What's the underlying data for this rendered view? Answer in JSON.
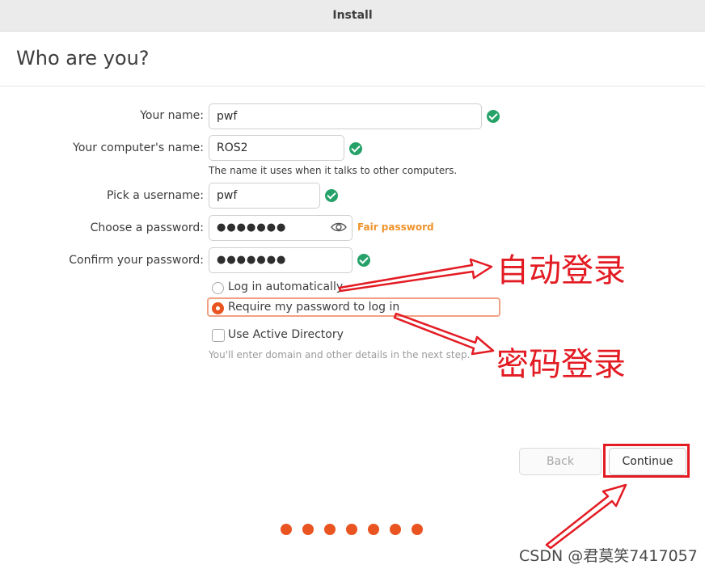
{
  "window": {
    "title": "Install"
  },
  "page": {
    "heading": "Who are you?"
  },
  "form": {
    "name_label": "Your name:",
    "name_value": "pwf",
    "computer_label": "Your computer's name:",
    "computer_value": "ROS2",
    "computer_hint": "The name it uses when it talks to other computers.",
    "username_label": "Pick a username:",
    "username_value": "pwf",
    "password_label": "Choose a password:",
    "password_value": "●●●●●●●",
    "password_strength": "Fair password",
    "confirm_label": "Confirm your password:",
    "confirm_value": "●●●●●●●"
  },
  "options": {
    "auto_login": "Log in automatically",
    "require_password": "Require my password to log in",
    "active_directory": "Use Active Directory",
    "active_directory_hint": "You'll enter domain and other details in the next step.",
    "selected": "require_password",
    "active_directory_checked": false
  },
  "buttons": {
    "back": "Back",
    "continue": "Continue"
  },
  "progress": {
    "total_steps": 7
  },
  "annotations": {
    "auto_login": "自动登录",
    "password_login": "密码登录"
  },
  "watermark": "CSDN @君莫笑7417057",
  "colors": {
    "accent": "#e95420",
    "success": "#26a269",
    "warning": "#f0932b",
    "annotation_red": "#e31b23"
  }
}
